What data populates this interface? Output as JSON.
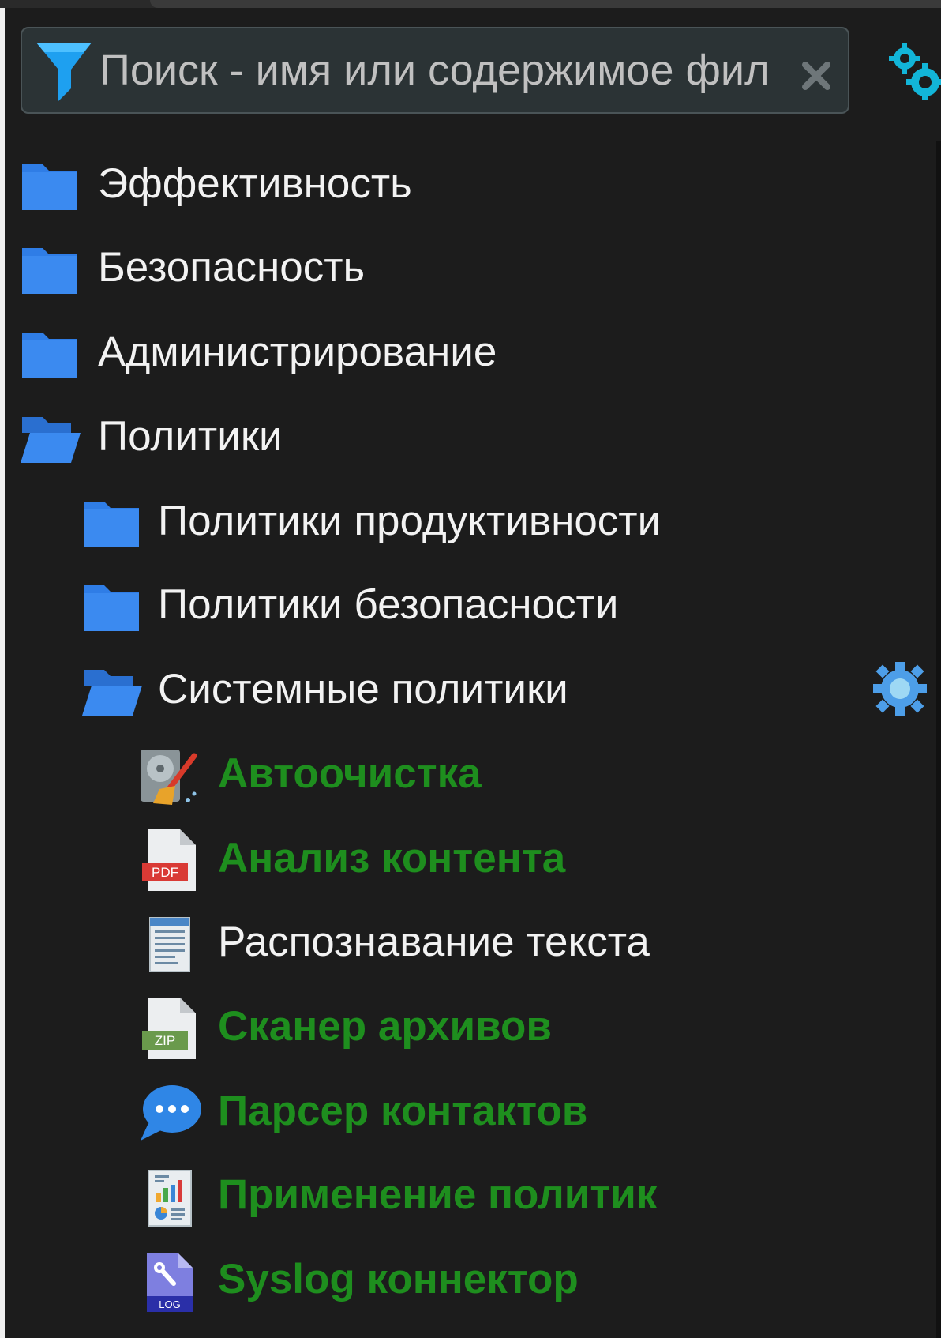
{
  "search": {
    "placeholder": "Поиск - имя или содержимое фил"
  },
  "icons": {
    "filter": "filter-icon",
    "clear": "close-icon",
    "settings": "gears-icon",
    "row_settings": "gear-icon"
  },
  "colors": {
    "background": "#1c1c1c",
    "search_bg": "#2b3335",
    "folder_blue": "#2f7de6",
    "active_policy_green": "#1e8e1e",
    "text_white": "#f2f2f2"
  },
  "tree": {
    "folders": [
      {
        "label": "Эффективность",
        "icon": "folder-icon"
      },
      {
        "label": "Безопасность",
        "icon": "folder-icon"
      },
      {
        "label": "Администрирование",
        "icon": "folder-icon"
      },
      {
        "label": "Политики",
        "icon": "folder-open-icon"
      }
    ],
    "policy_folders": [
      {
        "label": "Политики продуктивности",
        "icon": "folder-icon"
      },
      {
        "label": "Политики безопасности",
        "icon": "folder-icon"
      },
      {
        "label": "Системные политики",
        "icon": "folder-open-icon"
      }
    ],
    "system_policies": [
      {
        "label": "Автоочистка",
        "icon": "disk-cleanup-icon",
        "active": true
      },
      {
        "label": "Анализ контента",
        "icon": "pdf-file-icon",
        "active": true
      },
      {
        "label": "Распознавание текста",
        "icon": "text-document-icon",
        "active": false
      },
      {
        "label": "Сканер архивов",
        "icon": "zip-file-icon",
        "active": true
      },
      {
        "label": "Парсер контактов",
        "icon": "chat-bubble-icon",
        "active": true
      },
      {
        "label": "Применение политик",
        "icon": "report-chart-icon",
        "active": true
      },
      {
        "label": "Syslog коннектор",
        "icon": "log-file-icon",
        "active": true
      }
    ]
  },
  "file_badges": {
    "pdf": "PDF",
    "zip": "ZIP",
    "log": "LOG"
  }
}
